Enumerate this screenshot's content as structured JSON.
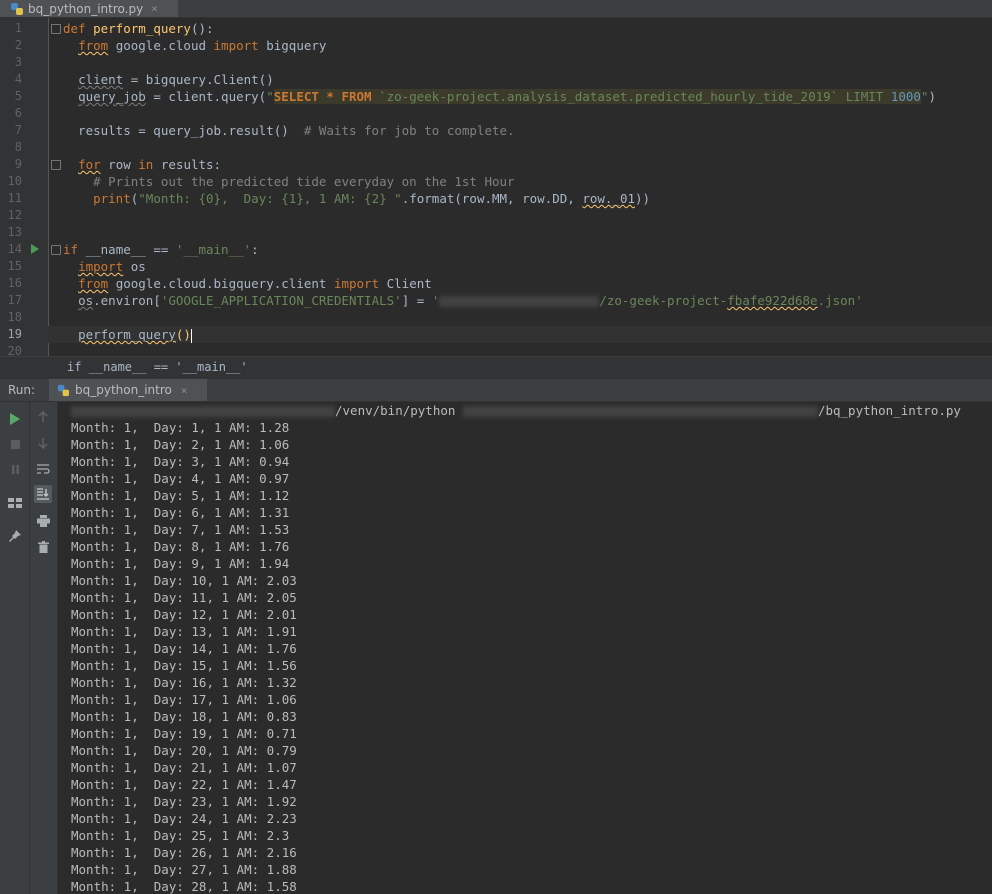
{
  "editor_tab": {
    "filename": "bq_python_intro.py",
    "close": "×"
  },
  "code_lines": [
    {
      "n": "1",
      "segs": [
        [
          "kw",
          "def "
        ],
        [
          "fn",
          "perform_query"
        ],
        [
          "",
          "():"
        ]
      ]
    },
    {
      "n": "2",
      "segs": [
        [
          "",
          "  "
        ],
        [
          "kw squig",
          "from"
        ],
        [
          "",
          " google.cloud "
        ],
        [
          "kw",
          "import"
        ],
        [
          "",
          " bigquery"
        ]
      ]
    },
    {
      "n": "3",
      "segs": []
    },
    {
      "n": "4",
      "segs": [
        [
          "",
          "  "
        ],
        [
          "squigg",
          "client"
        ],
        [
          "",
          " = bigquery.Client()"
        ]
      ]
    },
    {
      "n": "5",
      "segs": [
        [
          "",
          "  "
        ],
        [
          "squigg",
          "query_job"
        ],
        [
          "",
          " = client.query("
        ],
        [
          "str",
          "\""
        ],
        [
          "sqlkw hl-sql",
          "SELECT * FROM "
        ],
        [
          "str hl-sql",
          "`zo-geek-project.analysis_dataset.predicted_hourly_tide_2019` LIMIT "
        ],
        [
          "num hl-sql",
          "1000"
        ],
        [
          "str",
          "\""
        ],
        [
          "",
          ")"
        ]
      ]
    },
    {
      "n": "6",
      "segs": []
    },
    {
      "n": "7",
      "segs": [
        [
          "",
          "  results = query_job.result()  "
        ],
        [
          "cmt",
          "# Waits for job to complete."
        ]
      ]
    },
    {
      "n": "8",
      "segs": []
    },
    {
      "n": "9",
      "segs": [
        [
          "",
          "  "
        ],
        [
          "kw squig",
          "for"
        ],
        [
          "",
          " row "
        ],
        [
          "kw",
          "in"
        ],
        [
          "",
          " results:"
        ]
      ]
    },
    {
      "n": "10",
      "segs": [
        [
          "",
          "    "
        ],
        [
          "cmt",
          "# Prints out the predicted tide everyday on the 1st Hour"
        ]
      ]
    },
    {
      "n": "11",
      "segs": [
        [
          "",
          "    "
        ],
        [
          "kw",
          "print"
        ],
        [
          "",
          "("
        ],
        [
          "str",
          "\"Month: {0},  Day: {1}, 1 AM: {2} \""
        ],
        [
          "",
          ".format(row.MM, row.DD, "
        ],
        [
          "squig",
          "row._01"
        ],
        [
          "",
          "))"
        ]
      ]
    },
    {
      "n": "12",
      "segs": []
    },
    {
      "n": "13",
      "segs": []
    },
    {
      "n": "14",
      "segs": [
        [
          "kw",
          "if"
        ],
        [
          "",
          " __name__ == "
        ],
        [
          "str",
          "'__main__'"
        ],
        [
          "",
          ":"
        ]
      ]
    },
    {
      "n": "15",
      "segs": [
        [
          "",
          "  "
        ],
        [
          "kw squig",
          "import"
        ],
        [
          "",
          " os"
        ]
      ]
    },
    {
      "n": "16",
      "segs": [
        [
          "",
          "  "
        ],
        [
          "kw squig",
          "from"
        ],
        [
          "",
          " google.cloud.bigquery.client "
        ],
        [
          "kw",
          "import"
        ],
        [
          "",
          " Client"
        ]
      ]
    },
    {
      "n": "17",
      "segs": [
        [
          "",
          "  "
        ],
        [
          "squigg",
          "os"
        ],
        [
          "",
          ".environ["
        ],
        [
          "str",
          "'GOOGLE_APPLICATION_CREDENTIALS'"
        ],
        [
          "",
          "] = "
        ],
        [
          "str",
          "'"
        ],
        [
          "blur",
          "                    "
        ],
        [
          "str",
          "/zo-geek-project-"
        ],
        [
          "str squig",
          "fbafe922d68e"
        ],
        [
          "str",
          ".json'"
        ]
      ]
    },
    {
      "n": "18",
      "segs": []
    },
    {
      "n": "19",
      "segs": [
        [
          "",
          "  "
        ],
        [
          "squig",
          "perform_query"
        ],
        [
          "fn",
          "()"
        ],
        [
          "caret",
          ""
        ]
      ]
    },
    {
      "n": "20",
      "segs": []
    }
  ],
  "breadcrumb": "if __name__ == '__main__'",
  "run_panel": {
    "label": "Run:",
    "tab_name": "bq_python_intro",
    "close": "×",
    "command_mid": "/venv/bin/python ",
    "command_end": "/bq_python_intro.py"
  },
  "icons": {
    "run": "play-icon",
    "stop": "stop-icon",
    "pause": "pause-icon",
    "layout": "layout-icon",
    "pin": "pin-icon",
    "up": "arrow-up-icon",
    "down": "arrow-down-icon",
    "wrap": "soft-wrap-icon",
    "scroll": "scroll-to-end-icon",
    "print": "print-icon",
    "trash": "trash-icon"
  },
  "output_lines": [
    "Month: 1,  Day: 1, 1 AM: 1.28",
    "Month: 1,  Day: 2, 1 AM: 1.06",
    "Month: 1,  Day: 3, 1 AM: 0.94",
    "Month: 1,  Day: 4, 1 AM: 0.97",
    "Month: 1,  Day: 5, 1 AM: 1.12",
    "Month: 1,  Day: 6, 1 AM: 1.31",
    "Month: 1,  Day: 7, 1 AM: 1.53",
    "Month: 1,  Day: 8, 1 AM: 1.76",
    "Month: 1,  Day: 9, 1 AM: 1.94",
    "Month: 1,  Day: 10, 1 AM: 2.03",
    "Month: 1,  Day: 11, 1 AM: 2.05",
    "Month: 1,  Day: 12, 1 AM: 2.01",
    "Month: 1,  Day: 13, 1 AM: 1.91",
    "Month: 1,  Day: 14, 1 AM: 1.76",
    "Month: 1,  Day: 15, 1 AM: 1.56",
    "Month: 1,  Day: 16, 1 AM: 1.32",
    "Month: 1,  Day: 17, 1 AM: 1.06",
    "Month: 1,  Day: 18, 1 AM: 0.83",
    "Month: 1,  Day: 19, 1 AM: 0.71",
    "Month: 1,  Day: 20, 1 AM: 0.79",
    "Month: 1,  Day: 21, 1 AM: 1.07",
    "Month: 1,  Day: 22, 1 AM: 1.47",
    "Month: 1,  Day: 23, 1 AM: 1.92",
    "Month: 1,  Day: 24, 1 AM: 2.23",
    "Month: 1,  Day: 25, 1 AM: 2.3",
    "Month: 1,  Day: 26, 1 AM: 2.16",
    "Month: 1,  Day: 27, 1 AM: 1.88",
    "Month: 1,  Day: 28, 1 AM: 1.58"
  ]
}
